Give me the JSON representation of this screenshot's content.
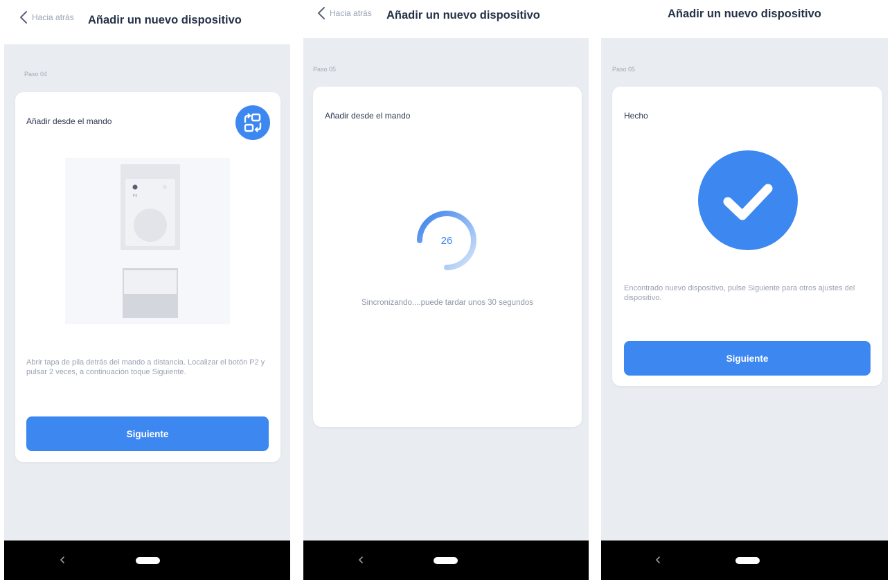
{
  "screens": [
    {
      "header": {
        "back_label": "Hacia atrás",
        "title": "Añadir un nuevo dispositivo"
      },
      "step": "Paso 04",
      "card_label": "Añadir desde el mando",
      "swap_icon": "swap-arrows-icon",
      "illustration": "remote-control-illustration",
      "instructions": "Abrir tapa de pila detrás del mando a distancia. Localizar el botón P2 y pulsar 2 veces, a continuación toque Siguiente.",
      "remote_button_label": "P2",
      "button_label": "Siguiente"
    },
    {
      "header": {
        "back_label": "Hacia atrás",
        "title": "Añadir un nuevo dispositivo"
      },
      "step": "Paso 05",
      "card_label": "Añadir desde el mando",
      "countdown": "26",
      "status": "Sincronizando....puede tardar unos 30 segundos"
    },
    {
      "header": {
        "title": "Añadir un nuevo dispositivo"
      },
      "step": "Paso 05",
      "card_label": "Hecho",
      "success_icon": "check-circle-icon",
      "message": "Encontrado nuevo dispositivo, pulse Siguiente para otros ajustes del dispositivo.",
      "button_label": "Siguiente"
    }
  ],
  "colors": {
    "accent": "#3d87f0",
    "background": "#e9ecf1",
    "nav_bar": "#000000"
  }
}
